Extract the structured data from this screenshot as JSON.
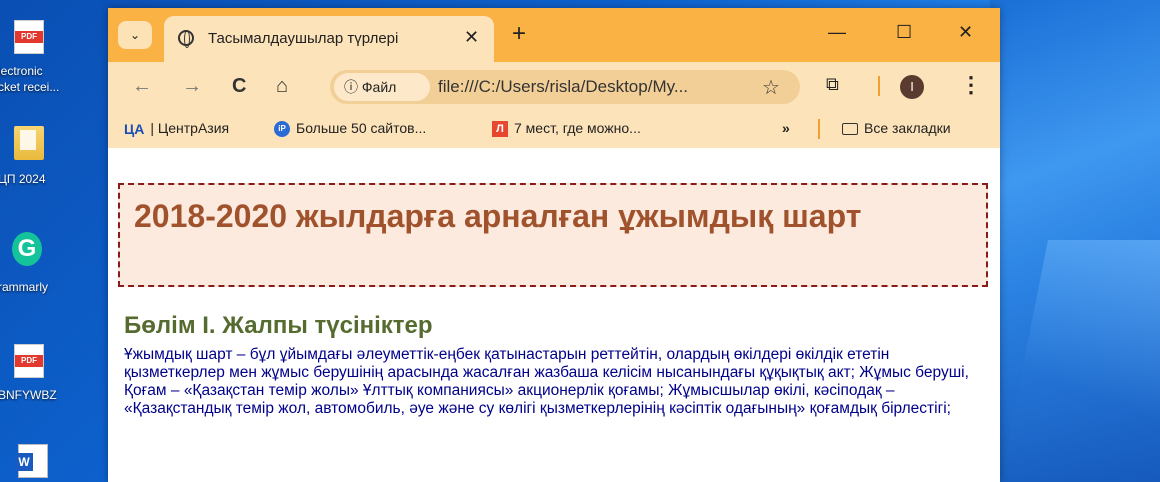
{
  "desktop": {
    "icons": [
      {
        "label": "lectronic\ncket recei...",
        "name": "pdf"
      },
      {
        "label": "ЦП 2024",
        "name": "folder"
      },
      {
        "label": "rammarly",
        "name": "grammarly"
      },
      {
        "label": "BNFYWBZ",
        "name": "pdf"
      },
      {
        "label": "",
        "name": "word"
      }
    ],
    "icon_labels": {
      "electronic": "lectronic",
      "electronic2": "cket recei...",
      "folder": "ЦП 2024",
      "grammarly": "rammarly",
      "pdf2": "BNFYWBZ"
    }
  },
  "browser": {
    "tab": {
      "title": "Тасымалдаушылар түрлері",
      "close": "✕"
    },
    "new_tab": "+",
    "controls": {
      "minimize": "—",
      "maximize": "☐",
      "close": "✕"
    },
    "nav": {
      "back": "←",
      "forward": "→",
      "reload": "C",
      "home": "⌂"
    },
    "omnibox": {
      "chip": "ⓘ Файл",
      "url": "file:///C:/Users/risla/Desktop/My...",
      "star": "☆"
    },
    "profile_initial": "I",
    "menu": "⋮",
    "bookmarks": [
      {
        "icon": "ЦА",
        "label": "| ЦентрАзия"
      },
      {
        "icon": "iP",
        "label": "Больше 50 сайтов..."
      },
      {
        "icon": "Л",
        "label": "7 мест, где можно..."
      }
    ],
    "bookmarks_more": "»",
    "all_bookmarks": "Все закладки"
  },
  "page": {
    "title": "2018-2020 жылдарға арналған ұжымдық шарт",
    "section_heading": "Бөлім I. Жалпы түсініктер",
    "paragraph": "Ұжымдық шарт – бұл ұйымдағы әлеуметтік-еңбек қатынастарын реттейтін, олардың өкілдері өкілдік ететін қызметкерлер мен жұмыс берушінің арасында жасалған жазбаша келісім нысанындағы құқықтық акт; Жұмыс беруші, Қоғам – «Қазақстан темір жолы» Ұлттық компаниясы» акционерлік қоғамы; Жұмысшылар өкілі, кәсіподақ – «Қазақстандық темір жол, автомобиль, әуе және су көлігі қызметкерлерінің кәсіптік одағының» қоғамдық бірлестігі;",
    "colors": {
      "title": "#a0522d",
      "section": "#556b2f",
      "text": "#00008b",
      "border": "#8b1a1a"
    }
  }
}
